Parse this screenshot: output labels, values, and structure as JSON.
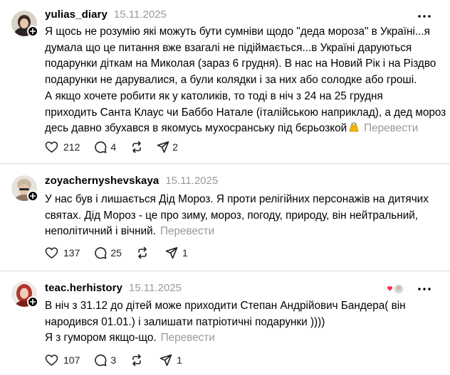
{
  "posts": [
    {
      "username": "yulias_diary",
      "date": "15.11.2025",
      "lines": [
        "Я щось не розумію які можуть бути сумніви щодо \"деда мороза\" в Україні...я",
        "думала що це питання вже взагалі не підіймається...в Україні даруються",
        "подарунки діткам на Миколая (зараз 6 грудня). В нас на Новий Рік і на Різдво",
        "подарунки не дарувалися, а були колядки і за них або солодке або гроші.",
        "А якщо хочете робити як у католиків, то тоді в ніч з 24 на 25 грудня",
        "приходить Санта Клаус чи Баббо Натале (італійською наприклад), а дед мороз",
        "десь давно збухався в якомусь мухосранську під бєрьозкой"
      ],
      "translate": "Перевести",
      "likes": "212",
      "comments": "4",
      "reposts": "",
      "shares": "2",
      "emoji_icon": "hands-emoji"
    },
    {
      "username": "zoyachernyshevskaya",
      "date": "15.11.2025",
      "lines": [
        "У нас був і лишається Дід Мороз. Я проти релігійних персонажів на дитячих",
        "святах. Дід Мороз - це про зиму, мороз, погоду, природу, він нейтральний,",
        "неполітичний і вічний."
      ],
      "translate": "Перевести",
      "likes": "137",
      "comments": "25",
      "reposts": "",
      "shares": "1"
    },
    {
      "username": "teac.herhistory",
      "date": "15.11.2025",
      "lines": [
        "В ніч з 31.12 до дітей може приходити Степан Андрійович Бандера( він",
        "народився 01.01.) і залишати патріотичні подарунки ))))",
        "Я з гумором якщо-що."
      ],
      "translate": "Перевести",
      "likes": "107",
      "comments": "3",
      "reposts": "",
      "shares": "1"
    }
  ],
  "icons": {
    "like": "heart-icon",
    "comment": "comment-icon",
    "repost": "repost-icon",
    "share": "send-icon",
    "more": "more-icon",
    "follow": "plus-icon"
  },
  "colors": {
    "text": "#000000",
    "muted": "#999999",
    "divider": "#dbdbdb",
    "icon": "#222222"
  }
}
